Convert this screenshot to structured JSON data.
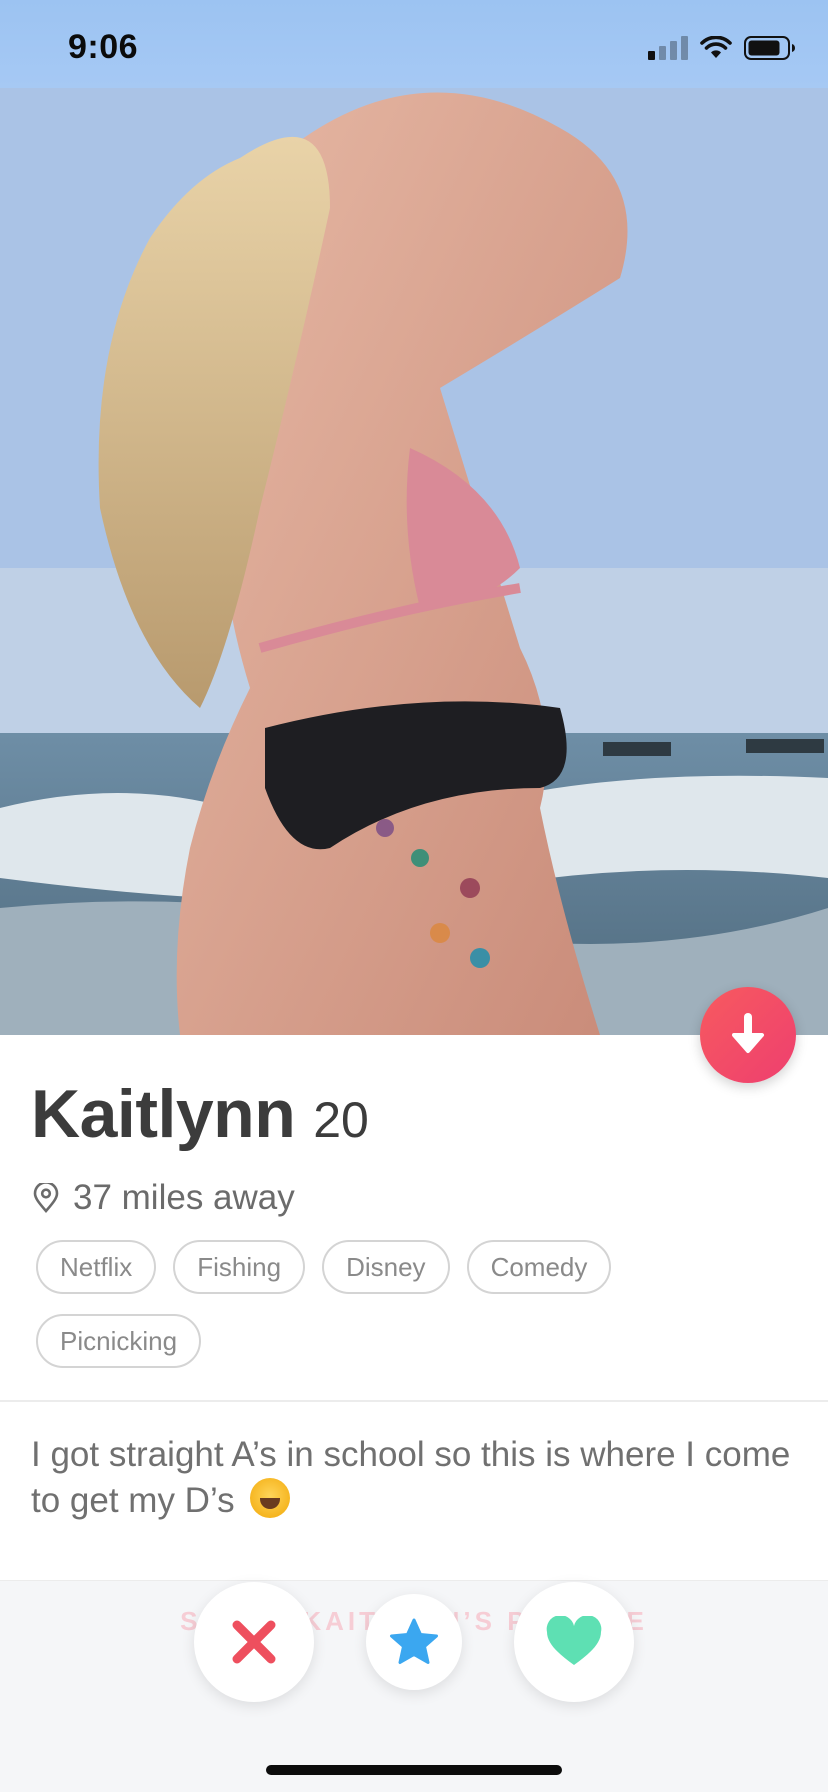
{
  "status_bar": {
    "time": "9:06"
  },
  "profile": {
    "name": "Kaitlynn",
    "age": "20",
    "distance": "37 miles away",
    "interests": [
      "Netflix",
      "Fishing",
      "Disney",
      "Comedy",
      "Picnicking"
    ],
    "bio": "I got straight A’s in school so this is where I come to get my D’s"
  },
  "footer": {
    "share_label": "SHARE KAITLYNN’S PROFILE"
  },
  "icons": {
    "info": "arrow-down-icon",
    "location": "location-pin-icon",
    "nope": "x-icon",
    "super_like": "star-icon",
    "like": "heart-icon",
    "bio_emoji": "face-with-tears-of-joy-emoji"
  },
  "colors": {
    "accent": "#F2456A",
    "nope": "#EE4F5E",
    "super_like": "#3BA7F0",
    "like": "#5EE0B3",
    "text_primary": "#3C3C3C",
    "text_secondary": "#6B6B6B"
  }
}
